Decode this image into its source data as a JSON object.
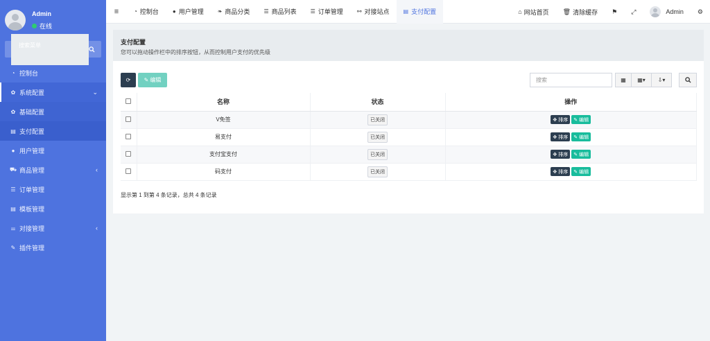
{
  "sidebar": {
    "user_name": "Admin",
    "user_status": "在线",
    "search_placeholder": "搜索菜单",
    "items": [
      {
        "label": "控制台",
        "icon": "dashboard-icon"
      },
      {
        "label": "系统配置",
        "icon": "gear-icon",
        "open": true
      },
      {
        "label": "基础配置",
        "icon": "gear-icon",
        "sub": true
      },
      {
        "label": "支付配置",
        "icon": "card-icon",
        "sub": true,
        "active": true
      },
      {
        "label": "用户管理",
        "icon": "user-icon"
      },
      {
        "label": "商品管理",
        "icon": "cart-icon",
        "expand": true
      },
      {
        "label": "订单管理",
        "icon": "list-icon"
      },
      {
        "label": "模板管理",
        "icon": "card-icon"
      },
      {
        "label": "对接管理",
        "icon": "sliders-icon",
        "expand": true
      },
      {
        "label": "插件管理",
        "icon": "plug-icon"
      }
    ]
  },
  "topbar": {
    "tabs": [
      {
        "label": "控制台",
        "icon": "dashboard-icon"
      },
      {
        "label": "用户管理",
        "icon": "user-icon"
      },
      {
        "label": "商品分类",
        "icon": "leaf-icon"
      },
      {
        "label": "商品列表",
        "icon": "list-icon"
      },
      {
        "label": "订单管理",
        "icon": "list-icon"
      },
      {
        "label": "对接站点",
        "icon": "sitemap-icon"
      },
      {
        "label": "支付配置",
        "icon": "card-icon",
        "active": true
      }
    ],
    "home_label": "网站首页",
    "clear_cache_label": "清除缓存",
    "user_name": "Admin"
  },
  "panel": {
    "title": "支付配置",
    "description": "您可以拖动操作栏中的排序按钮，从而控制用户支付的优先级",
    "edit_button": "编辑",
    "search_placeholder": "搜索",
    "columns": [
      "名称",
      "状态",
      "操作"
    ],
    "rows": [
      {
        "name": "V免签",
        "status": "已关闭"
      },
      {
        "name": "易支付",
        "status": "已关闭"
      },
      {
        "name": "支付宝支付",
        "status": "已关闭"
      },
      {
        "name": "码支付",
        "status": "已关闭"
      }
    ],
    "sort_label": "排序",
    "row_edit_label": "编辑",
    "footer": "显示第 1 到第 4 条记录，总共 4 条记录"
  },
  "colors": {
    "sidebar_bg": "#4e73df",
    "accent": "#4e73df",
    "dark_button": "#2c3e50",
    "success": "#18bc9c"
  }
}
